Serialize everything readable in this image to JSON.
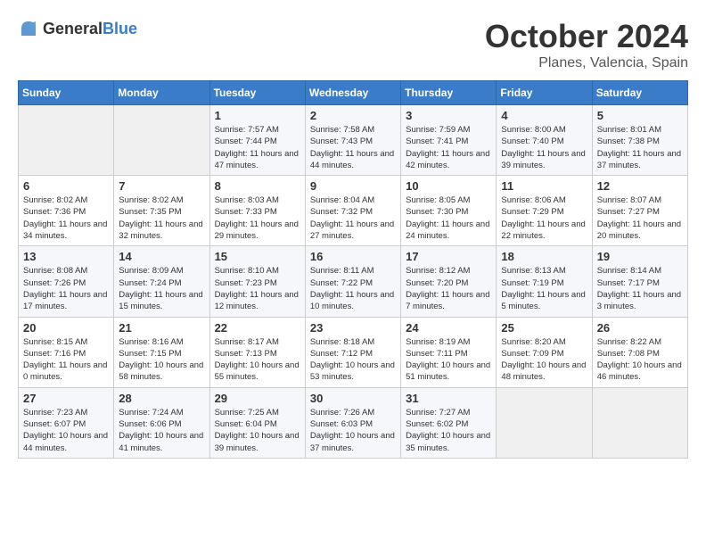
{
  "header": {
    "logo": {
      "general": "General",
      "blue": "Blue"
    },
    "title": "October 2024",
    "subtitle": "Planes, Valencia, Spain"
  },
  "weekdays": [
    "Sunday",
    "Monday",
    "Tuesday",
    "Wednesday",
    "Thursday",
    "Friday",
    "Saturday"
  ],
  "weeks": [
    [
      {
        "day": "",
        "info": ""
      },
      {
        "day": "",
        "info": ""
      },
      {
        "day": "1",
        "sunrise": "Sunrise: 7:57 AM",
        "sunset": "Sunset: 7:44 PM",
        "daylight": "Daylight: 11 hours and 47 minutes."
      },
      {
        "day": "2",
        "sunrise": "Sunrise: 7:58 AM",
        "sunset": "Sunset: 7:43 PM",
        "daylight": "Daylight: 11 hours and 44 minutes."
      },
      {
        "day": "3",
        "sunrise": "Sunrise: 7:59 AM",
        "sunset": "Sunset: 7:41 PM",
        "daylight": "Daylight: 11 hours and 42 minutes."
      },
      {
        "day": "4",
        "sunrise": "Sunrise: 8:00 AM",
        "sunset": "Sunset: 7:40 PM",
        "daylight": "Daylight: 11 hours and 39 minutes."
      },
      {
        "day": "5",
        "sunrise": "Sunrise: 8:01 AM",
        "sunset": "Sunset: 7:38 PM",
        "daylight": "Daylight: 11 hours and 37 minutes."
      }
    ],
    [
      {
        "day": "6",
        "sunrise": "Sunrise: 8:02 AM",
        "sunset": "Sunset: 7:36 PM",
        "daylight": "Daylight: 11 hours and 34 minutes."
      },
      {
        "day": "7",
        "sunrise": "Sunrise: 8:02 AM",
        "sunset": "Sunset: 7:35 PM",
        "daylight": "Daylight: 11 hours and 32 minutes."
      },
      {
        "day": "8",
        "sunrise": "Sunrise: 8:03 AM",
        "sunset": "Sunset: 7:33 PM",
        "daylight": "Daylight: 11 hours and 29 minutes."
      },
      {
        "day": "9",
        "sunrise": "Sunrise: 8:04 AM",
        "sunset": "Sunset: 7:32 PM",
        "daylight": "Daylight: 11 hours and 27 minutes."
      },
      {
        "day": "10",
        "sunrise": "Sunrise: 8:05 AM",
        "sunset": "Sunset: 7:30 PM",
        "daylight": "Daylight: 11 hours and 24 minutes."
      },
      {
        "day": "11",
        "sunrise": "Sunrise: 8:06 AM",
        "sunset": "Sunset: 7:29 PM",
        "daylight": "Daylight: 11 hours and 22 minutes."
      },
      {
        "day": "12",
        "sunrise": "Sunrise: 8:07 AM",
        "sunset": "Sunset: 7:27 PM",
        "daylight": "Daylight: 11 hours and 20 minutes."
      }
    ],
    [
      {
        "day": "13",
        "sunrise": "Sunrise: 8:08 AM",
        "sunset": "Sunset: 7:26 PM",
        "daylight": "Daylight: 11 hours and 17 minutes."
      },
      {
        "day": "14",
        "sunrise": "Sunrise: 8:09 AM",
        "sunset": "Sunset: 7:24 PM",
        "daylight": "Daylight: 11 hours and 15 minutes."
      },
      {
        "day": "15",
        "sunrise": "Sunrise: 8:10 AM",
        "sunset": "Sunset: 7:23 PM",
        "daylight": "Daylight: 11 hours and 12 minutes."
      },
      {
        "day": "16",
        "sunrise": "Sunrise: 8:11 AM",
        "sunset": "Sunset: 7:22 PM",
        "daylight": "Daylight: 11 hours and 10 minutes."
      },
      {
        "day": "17",
        "sunrise": "Sunrise: 8:12 AM",
        "sunset": "Sunset: 7:20 PM",
        "daylight": "Daylight: 11 hours and 7 minutes."
      },
      {
        "day": "18",
        "sunrise": "Sunrise: 8:13 AM",
        "sunset": "Sunset: 7:19 PM",
        "daylight": "Daylight: 11 hours and 5 minutes."
      },
      {
        "day": "19",
        "sunrise": "Sunrise: 8:14 AM",
        "sunset": "Sunset: 7:17 PM",
        "daylight": "Daylight: 11 hours and 3 minutes."
      }
    ],
    [
      {
        "day": "20",
        "sunrise": "Sunrise: 8:15 AM",
        "sunset": "Sunset: 7:16 PM",
        "daylight": "Daylight: 11 hours and 0 minutes."
      },
      {
        "day": "21",
        "sunrise": "Sunrise: 8:16 AM",
        "sunset": "Sunset: 7:15 PM",
        "daylight": "Daylight: 10 hours and 58 minutes."
      },
      {
        "day": "22",
        "sunrise": "Sunrise: 8:17 AM",
        "sunset": "Sunset: 7:13 PM",
        "daylight": "Daylight: 10 hours and 55 minutes."
      },
      {
        "day": "23",
        "sunrise": "Sunrise: 8:18 AM",
        "sunset": "Sunset: 7:12 PM",
        "daylight": "Daylight: 10 hours and 53 minutes."
      },
      {
        "day": "24",
        "sunrise": "Sunrise: 8:19 AM",
        "sunset": "Sunset: 7:11 PM",
        "daylight": "Daylight: 10 hours and 51 minutes."
      },
      {
        "day": "25",
        "sunrise": "Sunrise: 8:20 AM",
        "sunset": "Sunset: 7:09 PM",
        "daylight": "Daylight: 10 hours and 48 minutes."
      },
      {
        "day": "26",
        "sunrise": "Sunrise: 8:22 AM",
        "sunset": "Sunset: 7:08 PM",
        "daylight": "Daylight: 10 hours and 46 minutes."
      }
    ],
    [
      {
        "day": "27",
        "sunrise": "Sunrise: 7:23 AM",
        "sunset": "Sunset: 6:07 PM",
        "daylight": "Daylight: 10 hours and 44 minutes."
      },
      {
        "day": "28",
        "sunrise": "Sunrise: 7:24 AM",
        "sunset": "Sunset: 6:06 PM",
        "daylight": "Daylight: 10 hours and 41 minutes."
      },
      {
        "day": "29",
        "sunrise": "Sunrise: 7:25 AM",
        "sunset": "Sunset: 6:04 PM",
        "daylight": "Daylight: 10 hours and 39 minutes."
      },
      {
        "day": "30",
        "sunrise": "Sunrise: 7:26 AM",
        "sunset": "Sunset: 6:03 PM",
        "daylight": "Daylight: 10 hours and 37 minutes."
      },
      {
        "day": "31",
        "sunrise": "Sunrise: 7:27 AM",
        "sunset": "Sunset: 6:02 PM",
        "daylight": "Daylight: 10 hours and 35 minutes."
      },
      {
        "day": "",
        "info": ""
      },
      {
        "day": "",
        "info": ""
      }
    ]
  ]
}
